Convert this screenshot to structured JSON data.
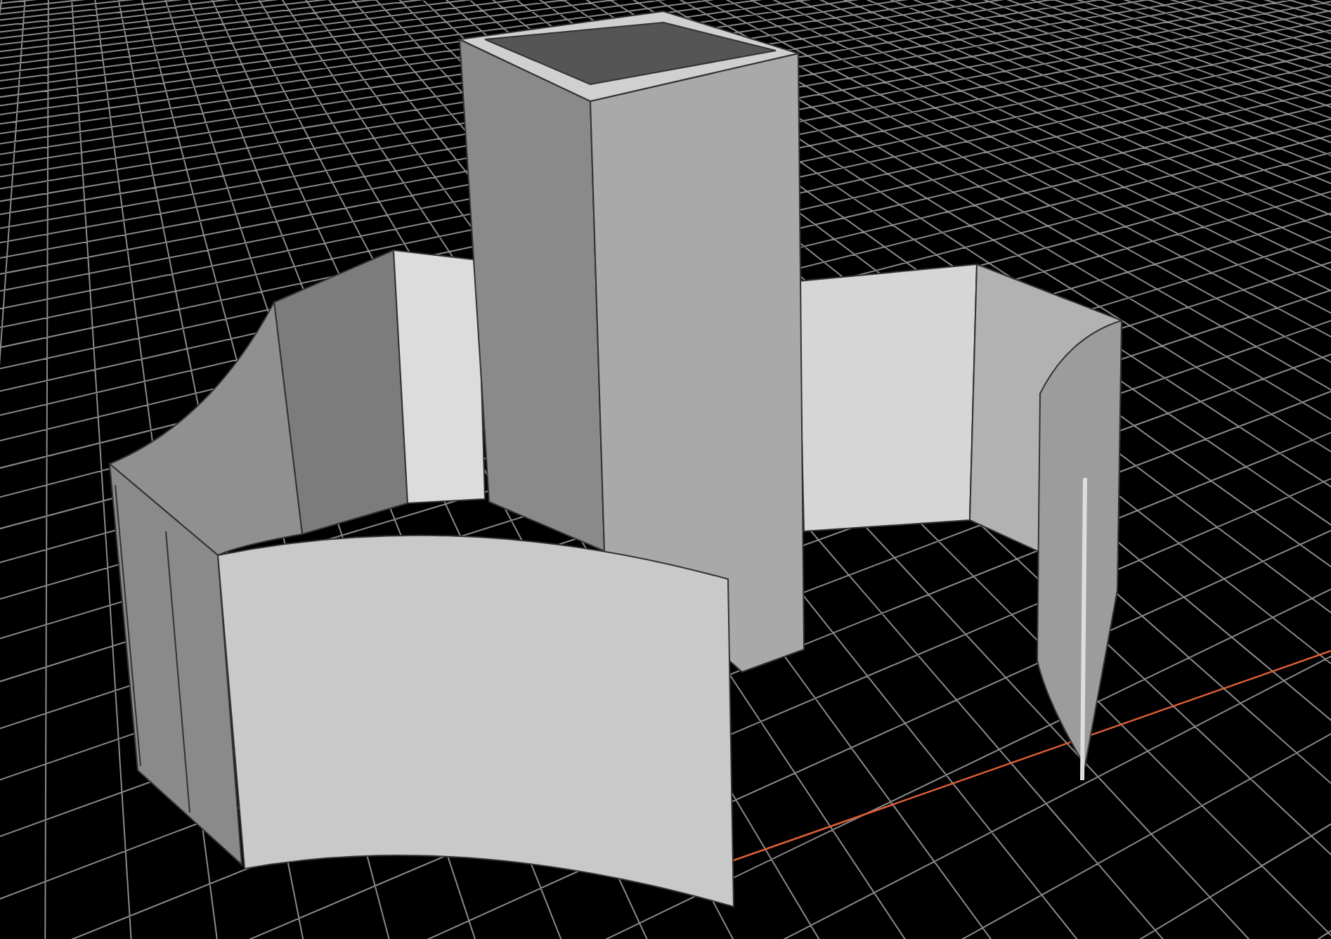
{
  "viewport": {
    "grid": true,
    "axis": true,
    "model": true
  }
}
